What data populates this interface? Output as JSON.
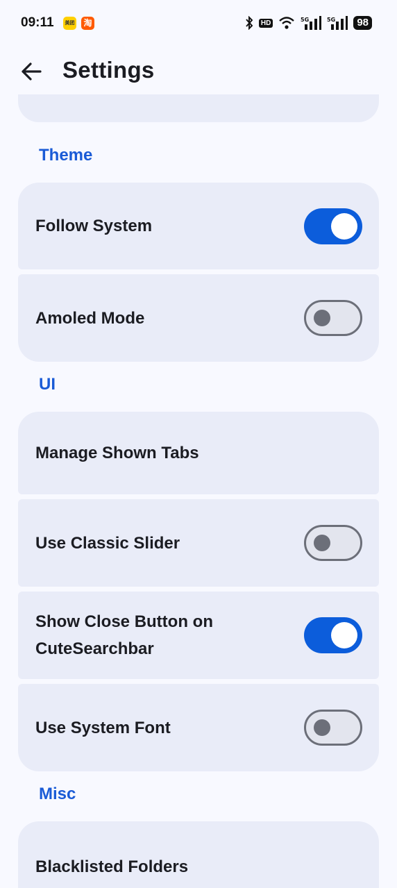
{
  "status_bar": {
    "time": "09:11",
    "notifications": [
      {
        "name": "meituan-icon",
        "label": "美团",
        "color": "#ffd000"
      },
      {
        "name": "taobao-icon",
        "label": "淘",
        "color": "#ff5a00"
      }
    ],
    "hd_label": "HD",
    "battery": "98"
  },
  "app_bar": {
    "title": "Settings",
    "back_icon": "arrow-left-icon"
  },
  "sections": {
    "theme": {
      "header": "Theme",
      "items": [
        {
          "label": "Follow System",
          "toggle": true
        },
        {
          "label": "Amoled Mode",
          "toggle": false
        }
      ]
    },
    "ui": {
      "header": "UI",
      "items": [
        {
          "label": "Manage Shown Tabs"
        },
        {
          "label": "Use Classic Slider",
          "toggle": false
        },
        {
          "label": "Show Close Button on CuteSearchbar",
          "toggle": true
        },
        {
          "label": "Use System Font",
          "toggle": false
        }
      ]
    },
    "misc": {
      "header": "Misc",
      "items": [
        {
          "label": "Blacklisted Folders"
        }
      ]
    }
  },
  "colors": {
    "accent": "#1a5bd6",
    "switch_on": "#0c5ddb",
    "card_bg": "#e9ecf8",
    "page_bg": "#f8f9ff"
  }
}
